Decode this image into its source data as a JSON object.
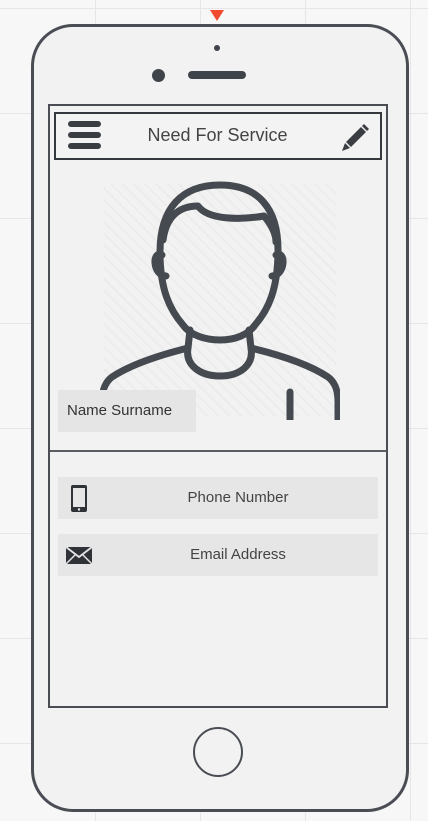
{
  "app": {
    "title": "Need For Service",
    "menu_icon": "hamburger-menu-icon",
    "edit_icon": "pencil-edit-icon"
  },
  "profile": {
    "avatar_icon": "user-avatar-icon",
    "name_label": "Name Surname"
  },
  "fields": {
    "phone": {
      "label": "Phone Number",
      "icon": "mobile-phone-icon"
    },
    "email": {
      "label": "Email Address",
      "icon": "envelope-icon"
    }
  },
  "colors": {
    "frame": "#4a4e54",
    "icon": "#3a3e43",
    "marker": "#f04a30",
    "field_bg": "#e6e6e6"
  }
}
